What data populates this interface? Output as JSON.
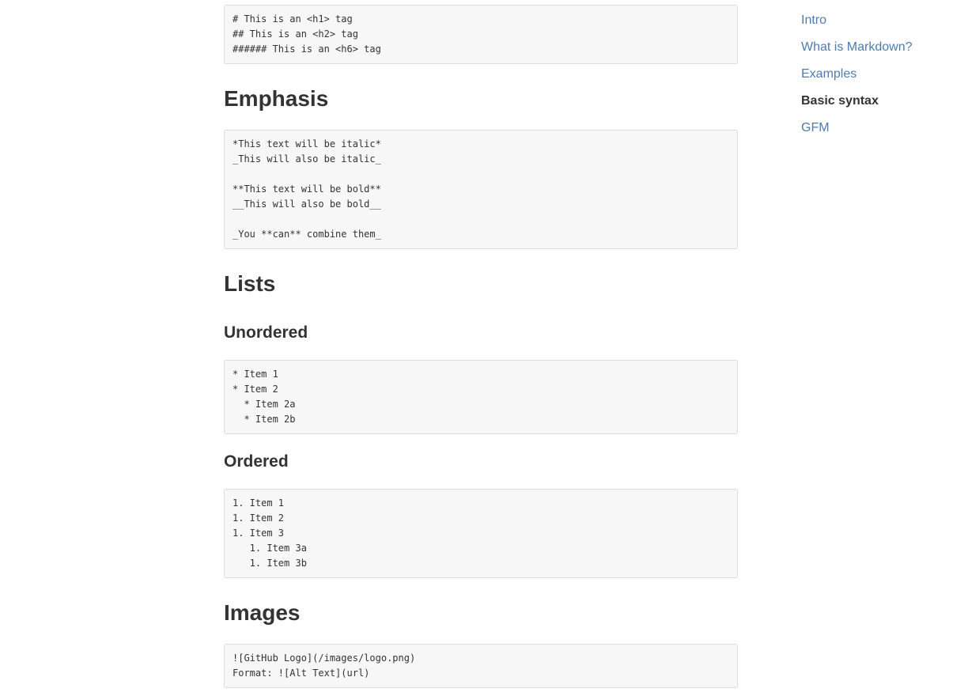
{
  "sections": {
    "headers_code": [
      "# This is an <h1> tag",
      "## This is an <h2> tag",
      "###### This is an <h6> tag"
    ],
    "emphasis": {
      "title": "Emphasis",
      "code": [
        "*This text will be italic*",
        "_This will also be italic_",
        "",
        "**This text will be bold**",
        "__This will also be bold__",
        "",
        "_You **can** combine them_"
      ]
    },
    "lists": {
      "title": "Lists",
      "unordered": {
        "title": "Unordered",
        "code": [
          "* Item 1",
          "* Item 2",
          "  * Item 2a",
          "  * Item 2b"
        ]
      },
      "ordered": {
        "title": "Ordered",
        "code": [
          "1. Item 1",
          "1. Item 2",
          "1. Item 3",
          "   1. Item 3a",
          "   1. Item 3b"
        ]
      }
    },
    "images": {
      "title": "Images",
      "code": [
        "![GitHub Logo](/images/logo.png)",
        "Format: ![Alt Text](url)"
      ]
    }
  },
  "toc": {
    "items": [
      {
        "label": "Intro",
        "active": false
      },
      {
        "label": "What is Markdown?",
        "active": false
      },
      {
        "label": "Examples",
        "active": false
      },
      {
        "label": "Basic syntax",
        "active": true
      },
      {
        "label": "GFM",
        "active": false
      }
    ]
  },
  "colors": {
    "link": "#4f7cb0",
    "text": "#333333",
    "code_bg": "#f7f7f7",
    "code_border": "#dcdcdc"
  }
}
